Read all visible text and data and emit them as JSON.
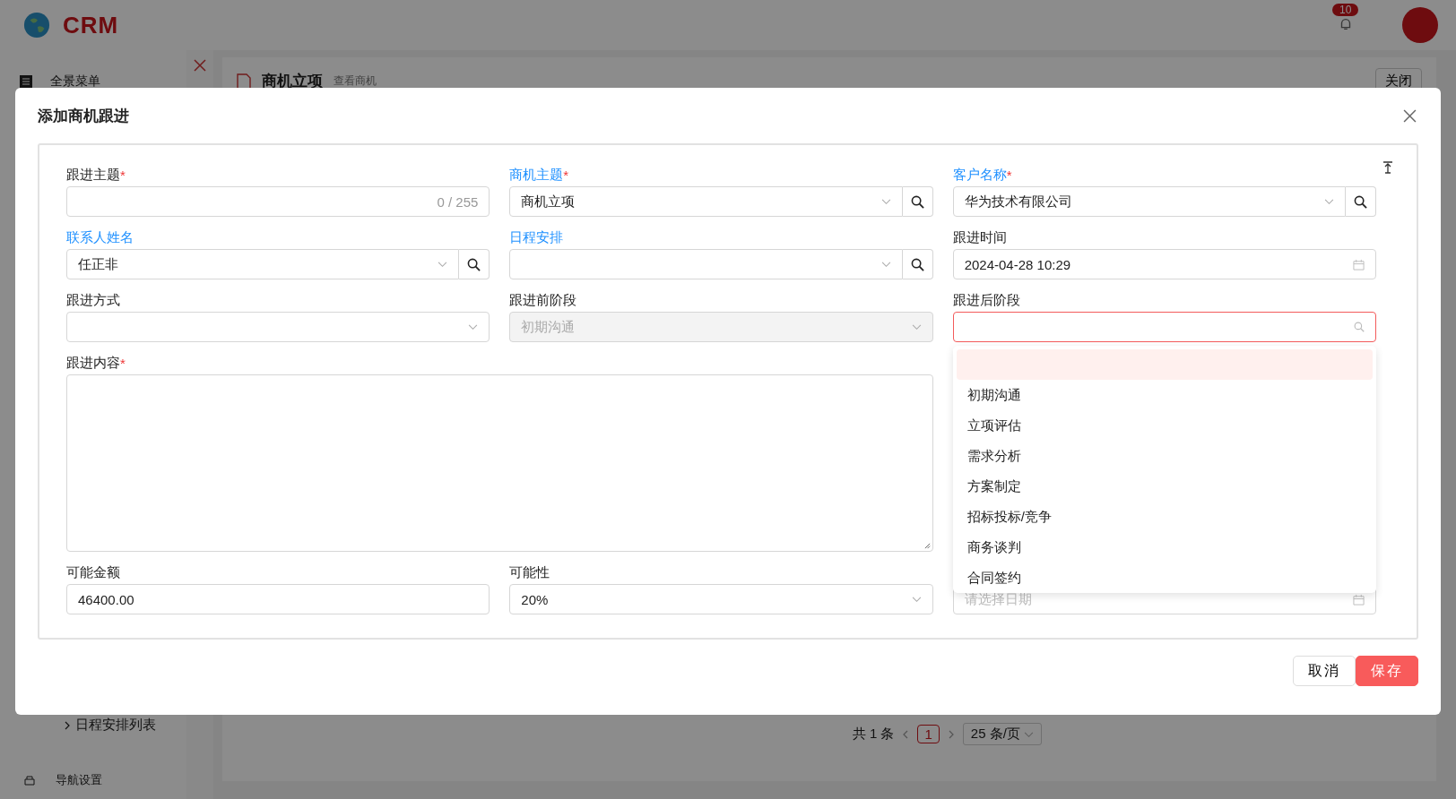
{
  "app": {
    "logo_text": "CRM",
    "notification_count": "10",
    "sidebar": {
      "menu_title": "全景菜单",
      "items": [
        {
          "label": "日程安排列表"
        }
      ],
      "footer": "导航设置"
    },
    "tab": {
      "title": "商机立项",
      "subtitle": "查看商机",
      "close_button": "关闭"
    },
    "pagination": {
      "total": "共 1 条",
      "pages": [
        {
          "label": "1",
          "selected": true
        }
      ],
      "page_size": "25 条/页"
    }
  },
  "dialog": {
    "title": "添加商机跟进",
    "fields": [
      {
        "kind": "text",
        "label": "跟进主题",
        "required_mark": "*",
        "link": false,
        "counter": "0 / 255"
      },
      {
        "kind": "lookup",
        "label": "商机主题",
        "required_mark": "*",
        "link": true,
        "value": "商机立项"
      },
      {
        "kind": "lookup",
        "label": "客户名称",
        "required_mark": "*",
        "link": true,
        "value": "华为技术有限公司"
      },
      {
        "kind": "lookup",
        "label": "联系人姓名",
        "link": true,
        "value": "任正非"
      },
      {
        "kind": "lookup",
        "label": "日程安排",
        "link": true
      },
      {
        "kind": "date",
        "label": "跟进时间",
        "link": false,
        "value": "2024-04-28 10:29"
      },
      {
        "kind": "select",
        "label": "跟进方式",
        "link": false
      },
      {
        "kind": "select",
        "label": "跟进前阶段",
        "link": false,
        "value": "初期沟通",
        "disabled": true
      },
      {
        "kind": "search-select",
        "label": "跟进后阶段",
        "link": false,
        "focused": true,
        "dropdown": {
          "blank_option_hovered": true,
          "options": [
            "初期沟通",
            "立项评估",
            "需求分析",
            "方案制定",
            "招标投标/竞争",
            "商务谈判",
            "合同签约"
          ]
        }
      },
      {
        "kind": "textarea",
        "label": "跟进内容",
        "required_mark": "*",
        "link": false
      },
      {
        "kind": "text",
        "label": "可能金额",
        "link": false,
        "value": "46400.00"
      },
      {
        "kind": "select",
        "label": "可能性",
        "link": false,
        "value": "20%"
      },
      {
        "kind": "date",
        "placeholder": "请选择日期"
      }
    ],
    "buttons": [
      {
        "label": "取消",
        "primary": false
      },
      {
        "label": "保存",
        "primary": true
      }
    ]
  }
}
